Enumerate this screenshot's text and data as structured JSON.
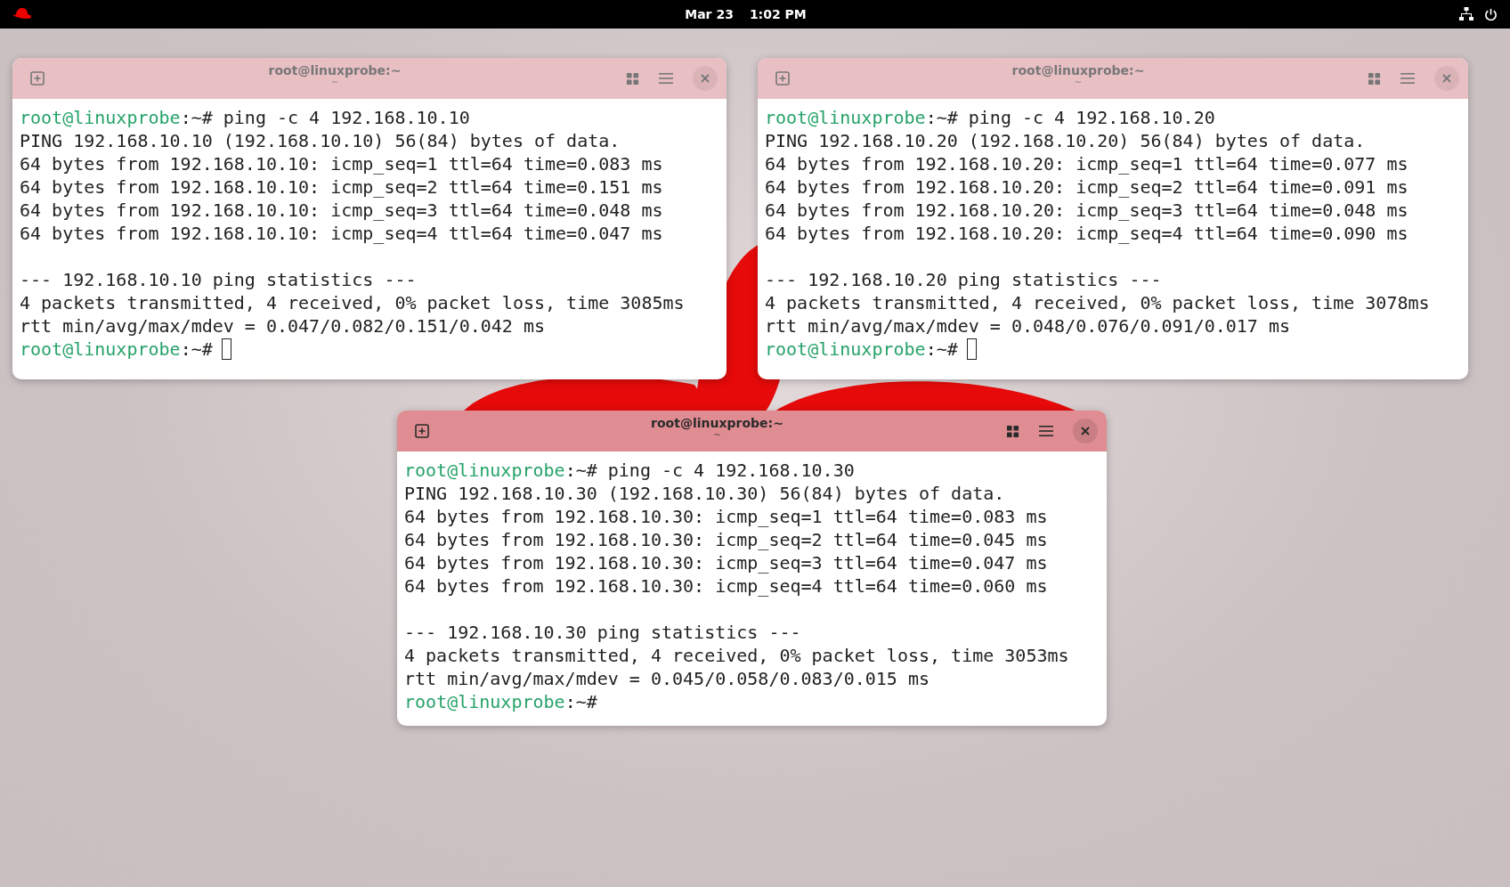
{
  "top_bar": {
    "date": "Mar 23",
    "time": "1:02 PM"
  },
  "windows": [
    {
      "title": "root@linuxprobe:~",
      "subtitle": "~",
      "focused": false,
      "lines": [
        {
          "kind": "prompt",
          "user": "root@linuxprobe",
          "path": ":~#",
          "command": "ping -c 4 192.168.10.10"
        },
        {
          "kind": "output",
          "text": "PING 192.168.10.10 (192.168.10.10) 56(84) bytes of data."
        },
        {
          "kind": "output",
          "text": "64 bytes from 192.168.10.10: icmp_seq=1 ttl=64 time=0.083 ms"
        },
        {
          "kind": "output",
          "text": "64 bytes from 192.168.10.10: icmp_seq=2 ttl=64 time=0.151 ms"
        },
        {
          "kind": "output",
          "text": "64 bytes from 192.168.10.10: icmp_seq=3 ttl=64 time=0.048 ms"
        },
        {
          "kind": "output",
          "text": "64 bytes from 192.168.10.10: icmp_seq=4 ttl=64 time=0.047 ms"
        },
        {
          "kind": "blank"
        },
        {
          "kind": "output",
          "text": "--- 192.168.10.10 ping statistics ---"
        },
        {
          "kind": "output",
          "text": "4 packets transmitted, 4 received, 0% packet loss, time 3085ms"
        },
        {
          "kind": "output",
          "text": "rtt min/avg/max/mdev = 0.047/0.082/0.151/0.042 ms"
        },
        {
          "kind": "prompt",
          "user": "root@linuxprobe",
          "path": ":~#",
          "cursor": true
        }
      ]
    },
    {
      "title": "root@linuxprobe:~",
      "subtitle": "~",
      "focused": false,
      "lines": [
        {
          "kind": "prompt",
          "user": "root@linuxprobe",
          "path": ":~#",
          "command": "ping -c 4 192.168.10.20"
        },
        {
          "kind": "output",
          "text": "PING 192.168.10.20 (192.168.10.20) 56(84) bytes of data."
        },
        {
          "kind": "output",
          "text": "64 bytes from 192.168.10.20: icmp_seq=1 ttl=64 time=0.077 ms"
        },
        {
          "kind": "output",
          "text": "64 bytes from 192.168.10.20: icmp_seq=2 ttl=64 time=0.091 ms"
        },
        {
          "kind": "output",
          "text": "64 bytes from 192.168.10.20: icmp_seq=3 ttl=64 time=0.048 ms"
        },
        {
          "kind": "output",
          "text": "64 bytes from 192.168.10.20: icmp_seq=4 ttl=64 time=0.090 ms"
        },
        {
          "kind": "blank"
        },
        {
          "kind": "output",
          "text": "--- 192.168.10.20 ping statistics ---"
        },
        {
          "kind": "output",
          "text": "4 packets transmitted, 4 received, 0% packet loss, time 3078ms"
        },
        {
          "kind": "output",
          "text": "rtt min/avg/max/mdev = 0.048/0.076/0.091/0.017 ms"
        },
        {
          "kind": "prompt",
          "user": "root@linuxprobe",
          "path": ":~#",
          "cursor": true
        }
      ]
    },
    {
      "title": "root@linuxprobe:~",
      "subtitle": "~",
      "focused": true,
      "lines": [
        {
          "kind": "prompt",
          "user": "root@linuxprobe",
          "path": ":~#",
          "command": "ping -c 4 192.168.10.30"
        },
        {
          "kind": "output",
          "text": "PING 192.168.10.30 (192.168.10.30) 56(84) bytes of data."
        },
        {
          "kind": "output",
          "text": "64 bytes from 192.168.10.30: icmp_seq=1 ttl=64 time=0.083 ms"
        },
        {
          "kind": "output",
          "text": "64 bytes from 192.168.10.30: icmp_seq=2 ttl=64 time=0.045 ms"
        },
        {
          "kind": "output",
          "text": "64 bytes from 192.168.10.30: icmp_seq=3 ttl=64 time=0.047 ms"
        },
        {
          "kind": "output",
          "text": "64 bytes from 192.168.10.30: icmp_seq=4 ttl=64 time=0.060 ms"
        },
        {
          "kind": "blank"
        },
        {
          "kind": "output",
          "text": "--- 192.168.10.30 ping statistics ---"
        },
        {
          "kind": "output",
          "text": "4 packets transmitted, 4 received, 0% packet loss, time 3053ms"
        },
        {
          "kind": "output",
          "text": "rtt min/avg/max/mdev = 0.045/0.058/0.083/0.015 ms"
        },
        {
          "kind": "prompt",
          "user": "root@linuxprobe",
          "path": ":~#",
          "cursor": false
        }
      ]
    }
  ]
}
